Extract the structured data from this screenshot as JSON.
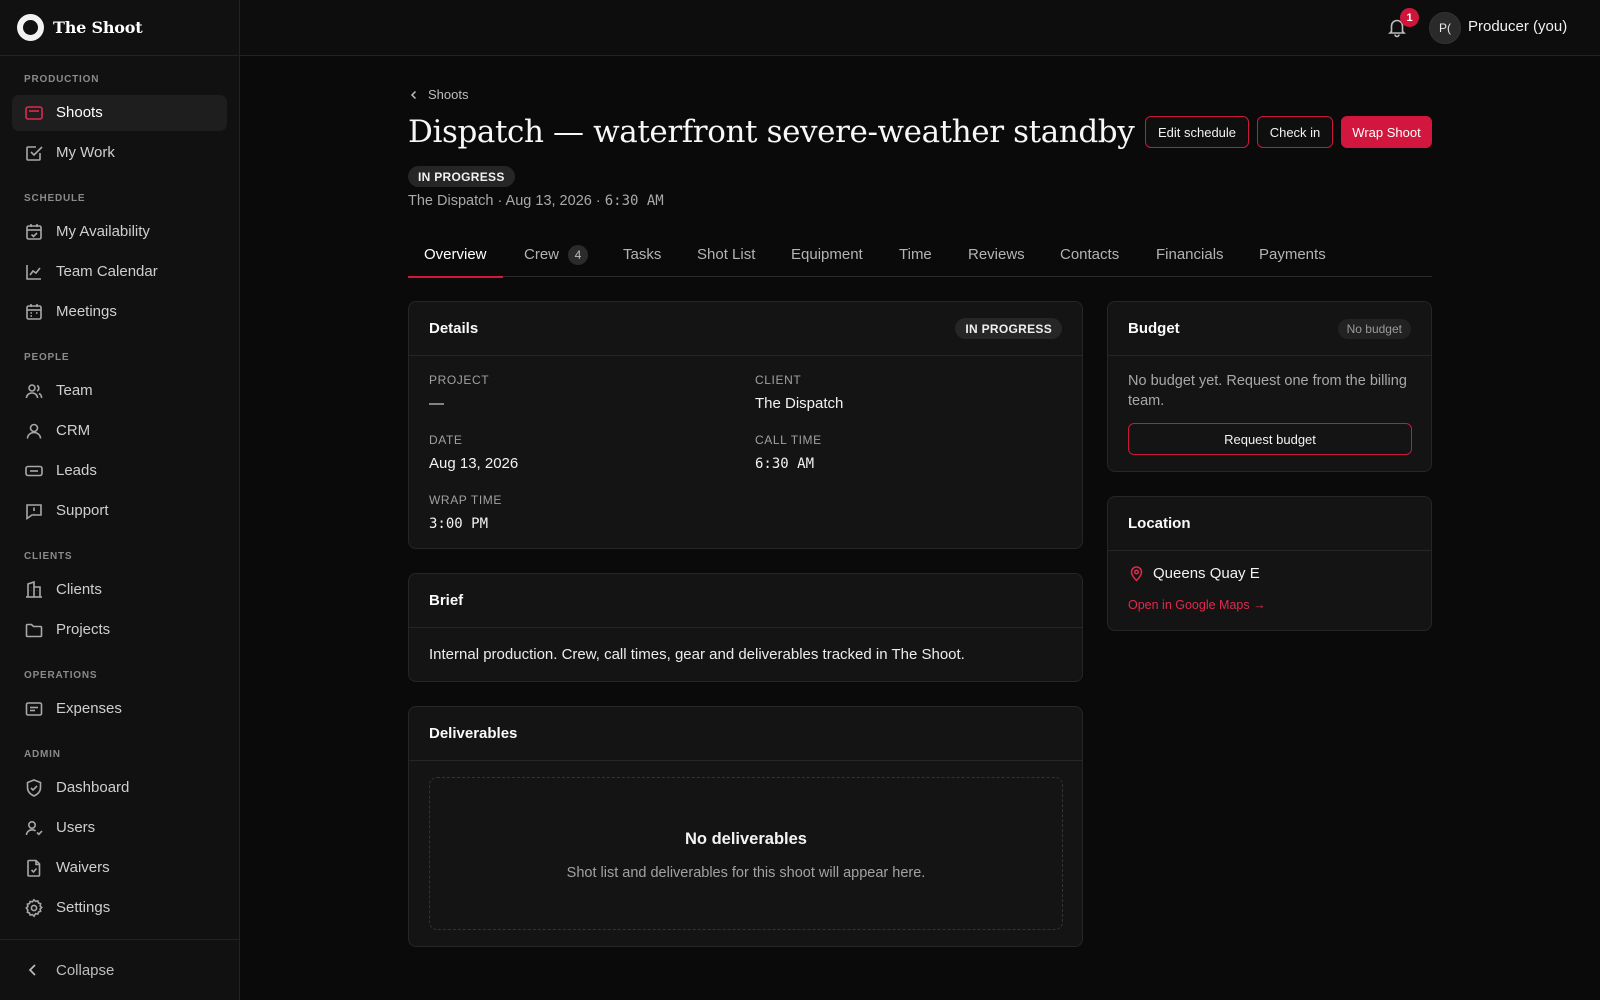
{
  "app": {
    "name": "The Shoot"
  },
  "sidebar": {
    "sections": [
      {
        "label": "PRODUCTION",
        "items": [
          {
            "label": "Shoots",
            "icon": "shoots-icon"
          },
          {
            "label": "My Work",
            "icon": "check-square-icon"
          }
        ]
      },
      {
        "label": "SCHEDULE",
        "items": [
          {
            "label": "My Availability",
            "icon": "calendar-check-icon"
          },
          {
            "label": "Team Calendar",
            "icon": "chart-line-icon"
          },
          {
            "label": "Meetings",
            "icon": "calendar-icon"
          }
        ]
      },
      {
        "label": "PEOPLE",
        "items": [
          {
            "label": "Team",
            "icon": "users-icon"
          },
          {
            "label": "CRM",
            "icon": "user-icon"
          },
          {
            "label": "Leads",
            "icon": "ticket-icon"
          },
          {
            "label": "Support",
            "icon": "message-alert-icon"
          }
        ]
      },
      {
        "label": "CLIENTS",
        "items": [
          {
            "label": "Clients",
            "icon": "building-icon"
          },
          {
            "label": "Projects",
            "icon": "folder-icon"
          }
        ]
      },
      {
        "label": "OPERATIONS",
        "items": [
          {
            "label": "Expenses",
            "icon": "receipt-icon"
          }
        ]
      },
      {
        "label": "ADMIN",
        "items": [
          {
            "label": "Dashboard",
            "icon": "shield-check-icon"
          },
          {
            "label": "Users",
            "icon": "user-check-icon"
          },
          {
            "label": "Waivers",
            "icon": "file-check-icon"
          },
          {
            "label": "Settings",
            "icon": "gear-icon"
          }
        ]
      }
    ],
    "active_item": "Shoots",
    "collapse_label": "Collapse"
  },
  "topbar": {
    "notification_count": "1",
    "avatar_initials": "P(",
    "user_name": "Producer (you)"
  },
  "page": {
    "breadcrumb": "Shoots",
    "title": "Dispatch — waterfront severe-weather standby",
    "status": "IN PROGRESS",
    "meta_client": "The Dispatch",
    "meta_date": "Aug 13, 2026",
    "meta_time": "6:30 AM",
    "separator": "·"
  },
  "actions": {
    "edit_schedule": "Edit schedule",
    "check_in": "Check in",
    "wrap_shoot": "Wrap Shoot"
  },
  "tabs": [
    {
      "label": "Overview",
      "active": true
    },
    {
      "label": "Crew",
      "count": "4"
    },
    {
      "label": "Tasks"
    },
    {
      "label": "Shot List"
    },
    {
      "label": "Equipment"
    },
    {
      "label": "Time"
    },
    {
      "label": "Reviews"
    },
    {
      "label": "Contacts"
    },
    {
      "label": "Financials"
    },
    {
      "label": "Payments"
    }
  ],
  "details": {
    "title": "Details",
    "status": "IN PROGRESS",
    "project_label": "PROJECT",
    "project_value": "—",
    "client_label": "CLIENT",
    "client_value": "The Dispatch",
    "date_label": "DATE",
    "date_value": "Aug 13, 2026",
    "call_time_label": "CALL TIME",
    "call_time_value": "6:30 AM",
    "wrap_time_label": "WRAP TIME",
    "wrap_time_value": "3:00 PM"
  },
  "brief": {
    "title": "Brief",
    "text": "Internal production. Crew, call times, gear and deliverables tracked in The Shoot."
  },
  "deliverables": {
    "title": "Deliverables",
    "empty_title": "No deliverables",
    "empty_text": "Shot list and deliverables for this shoot will appear here."
  },
  "budget": {
    "title": "Budget",
    "badge": "No budget",
    "text": "No budget yet. Request one from the billing team.",
    "request_button": "Request budget"
  },
  "location": {
    "title": "Location",
    "address": "Queens Quay E",
    "maps_link": "Open in Google Maps →"
  },
  "colors": {
    "accent": "#d2163d",
    "background": "#0a0a0a",
    "sidebar": "#111111",
    "card": "#141414"
  }
}
